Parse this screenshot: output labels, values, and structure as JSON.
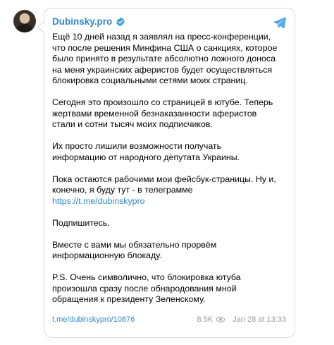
{
  "channel": {
    "name": "Dubinsky.pro",
    "verified": true
  },
  "post": {
    "paragraphs": [
      [
        "Ещё 10 дней назад я заявлял на пресс-конференции,",
        "что после решения Минфина США о санкциях, которое",
        "было принято в результате абсолютно ложного доноса",
        "на меня украинских аферистов будет осуществляться",
        "блокировка социальными сетями моих страниц."
      ],
      [
        "Сегодня это произошло со страницей в ютубе. Теперь",
        "жертвами временной безнаказанности аферистов",
        "стали и сотни тысяч моих подписчиков."
      ],
      [
        "Их просто лишили возможности получать",
        "информацию от народного депутата Украины."
      ],
      [
        "Пока остаются рабочими мои фейсбук-страницы. Ну и,",
        "конечно, я буду тут - в телеграмме"
      ],
      [
        "Подпишитесь."
      ],
      [
        "Вместе с вами мы обязательно прорвём",
        "информационную блокаду."
      ],
      [
        "P.S. Очень символично, что блокировка ютуба",
        "произошла сразу после обнародования мной",
        "обращения к президенту Зеленскому."
      ]
    ],
    "inline_link": "https://t.me/dubinskypro"
  },
  "footer": {
    "post_link": "t.me/dubinskypro/10876",
    "views": "8.5K",
    "date": "Jan 28 at 13:33"
  },
  "colors": {
    "accent": "#2f87c9",
    "muted": "#9a9a9a",
    "border": "#d8d8d8"
  },
  "icons": {
    "verified": "verified-badge-icon",
    "telegram": "telegram-plane-icon",
    "views": "eye-icon"
  }
}
